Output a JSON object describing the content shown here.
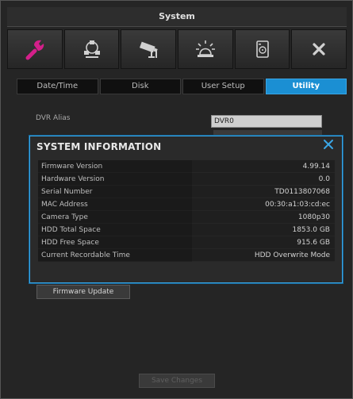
{
  "window": {
    "title": "System"
  },
  "toolbar": {
    "items": [
      {
        "icon": "wrench-icon",
        "active": true
      },
      {
        "icon": "network-icon"
      },
      {
        "icon": "camera-icon"
      },
      {
        "icon": "alarm-icon"
      },
      {
        "icon": "storage-icon"
      },
      {
        "icon": "close-icon"
      }
    ]
  },
  "tabs": [
    {
      "label": "Date/Time"
    },
    {
      "label": "Disk"
    },
    {
      "label": "User Setup"
    },
    {
      "label": "Utility",
      "active": true
    }
  ],
  "alias": {
    "label": "DVR Alias",
    "value": "DVR0"
  },
  "dialog": {
    "title": "SYSTEM INFORMATION",
    "rows": [
      {
        "key": "Firmware Version",
        "value": "4.99.14"
      },
      {
        "key": "Hardware Version",
        "value": "0.0"
      },
      {
        "key": "Serial Number",
        "value": "TD0113807068"
      },
      {
        "key": "MAC Address",
        "value": "00:30:a1:03:cd:ec"
      },
      {
        "key": "Camera Type",
        "value": "1080p30"
      },
      {
        "key": "HDD Total Space",
        "value": "1853.0 GB"
      },
      {
        "key": "HDD Free Space",
        "value": "915.6 GB"
      },
      {
        "key": "Current Recordable Time",
        "value": "HDD Overwrite Mode"
      }
    ]
  },
  "buttons": {
    "firmware_update": "Firmware Update",
    "save_changes": "Save Changes"
  },
  "colors": {
    "accent": "#1b8fd3",
    "wrench": "#d41f8a",
    "toolbar_icon": "#d0d0d0"
  }
}
